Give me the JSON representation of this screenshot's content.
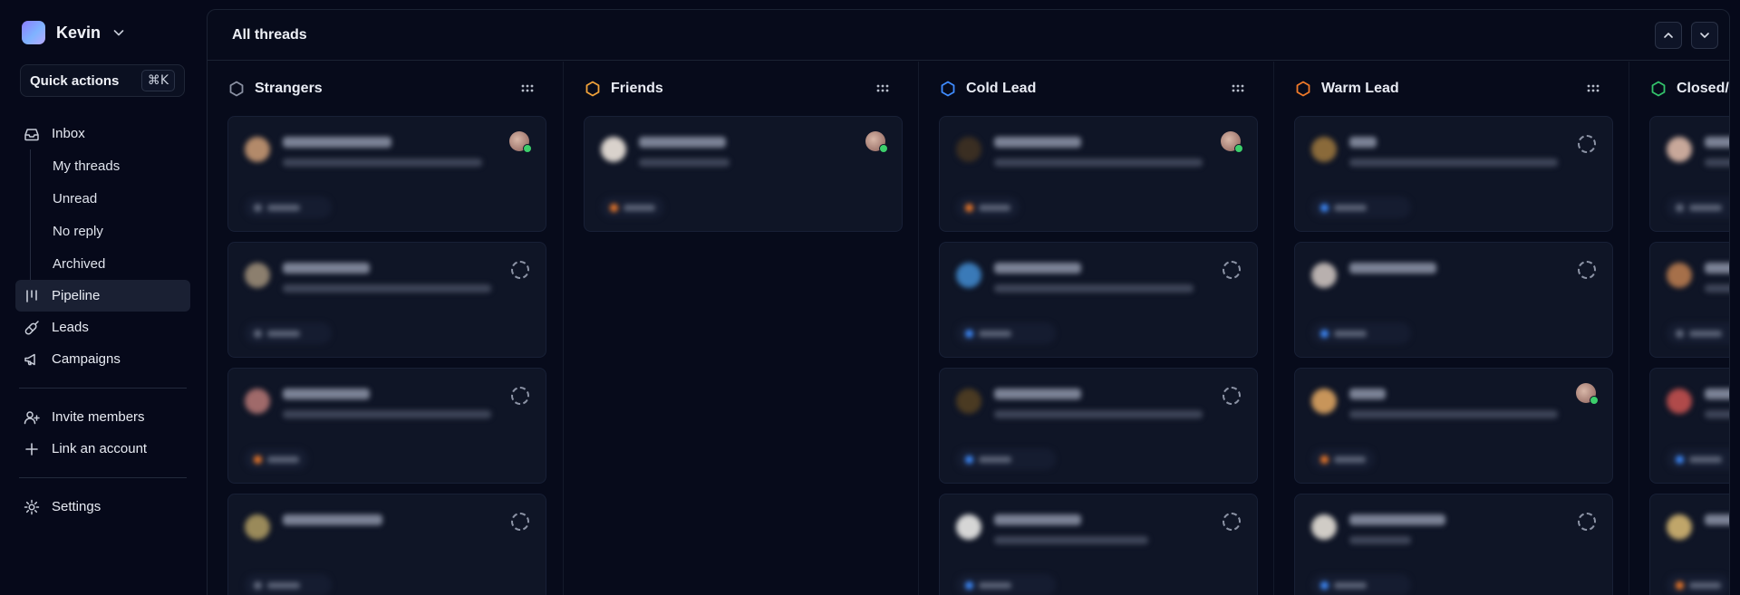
{
  "workspace": {
    "name": "Kevin",
    "chevron_icon": "chevron-down-icon"
  },
  "quick_actions": {
    "label": "Quick actions",
    "shortcut": "⌘K"
  },
  "nav": {
    "inbox": "Inbox",
    "my_threads": "My threads",
    "unread": "Unread",
    "no_reply": "No reply",
    "archived": "Archived",
    "pipeline": "Pipeline",
    "leads": "Leads",
    "campaigns": "Campaigns",
    "invite": "Invite members",
    "link": "Link an account",
    "settings": "Settings"
  },
  "main": {
    "title": "All threads"
  },
  "columns": [
    {
      "title": "Strangers",
      "color": "#8a91a3"
    },
    {
      "title": "Friends",
      "color": "#f0a23a"
    },
    {
      "title": "Cold Lead",
      "color": "#3f8cff"
    },
    {
      "title": "Warm Lead",
      "color": "#f07a2a"
    },
    {
      "title": "Closed/",
      "color": "#33c36b"
    }
  ],
  "colors": {
    "background": "#06091a",
    "card": "#0f1526",
    "active_nav": "#1a2033"
  }
}
